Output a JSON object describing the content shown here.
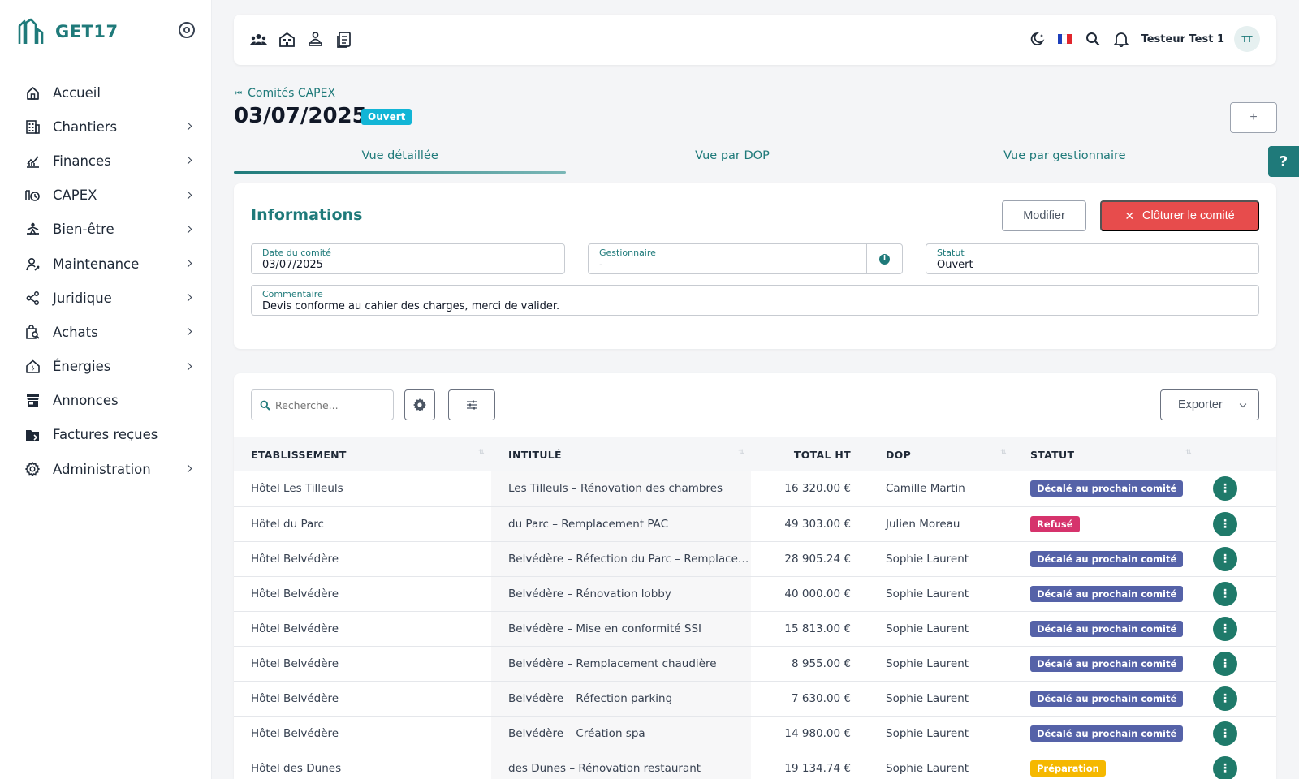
{
  "brand": {
    "name": "GET17",
    "color": "#1f7a7a"
  },
  "sidebar": {
    "items": [
      {
        "label": "Accueil",
        "icon": "home-icon",
        "chevron": false
      },
      {
        "label": "Chantiers",
        "icon": "building-icon",
        "chevron": true
      },
      {
        "label": "Finances",
        "icon": "chart-hand-icon",
        "chevron": true
      },
      {
        "label": "CAPEX",
        "icon": "capex-icon",
        "chevron": true
      },
      {
        "label": "Bien-être",
        "icon": "wellness-icon",
        "chevron": true
      },
      {
        "label": "Maintenance",
        "icon": "maintenance-icon",
        "chevron": true
      },
      {
        "label": "Juridique",
        "icon": "share-icon",
        "chevron": true
      },
      {
        "label": "Achats",
        "icon": "purchase-icon",
        "chevron": true
      },
      {
        "label": "Énergies",
        "icon": "energy-home-icon",
        "chevron": true
      },
      {
        "label": "Annonces",
        "icon": "store-icon",
        "chevron": false
      },
      {
        "label": "Factures reçues",
        "icon": "folder-invoice-icon",
        "chevron": false
      },
      {
        "label": "Administration",
        "icon": "gear-icon",
        "chevron": true
      }
    ]
  },
  "topbar": {
    "icons": [
      "users-icon",
      "hotel-icon",
      "person-desk-icon",
      "document-icon"
    ],
    "right_icons": [
      "dark-mode-icon",
      "french-flag-icon",
      "search-icon",
      "bell-icon"
    ],
    "user_name": "Testeur Test 1",
    "avatar_initials": "TT"
  },
  "header": {
    "breadcrumb": "Comités CAPEX",
    "title": "03/07/2025",
    "status_badge": "Ouvert",
    "add_label": "+"
  },
  "tabs": [
    {
      "label": "Vue détaillée",
      "active": true
    },
    {
      "label": "Vue par DOP",
      "active": false
    },
    {
      "label": "Vue par gestionnaire",
      "active": false
    }
  ],
  "help_label": "?",
  "info": {
    "title": "Informations",
    "modify_label": "Modifier",
    "close_label": "Clôturer le comité",
    "fields": {
      "date": {
        "label": "Date du comité",
        "value": "03/07/2025"
      },
      "manager": {
        "label": "Gestionnaire",
        "value": "-"
      },
      "status": {
        "label": "Statut",
        "value": "Ouvert"
      },
      "comment": {
        "label": "Commentaire",
        "value": "Devis conforme au cahier des charges, merci de valider."
      }
    }
  },
  "toolbar": {
    "search_placeholder": "Recherche...",
    "export_label": "Exporter"
  },
  "table": {
    "columns": [
      "ETABLISSEMENT",
      "INTITULÉ",
      "TOTAL HT",
      "DOP",
      "STATUT"
    ],
    "rows": [
      {
        "etab": "Hôtel Les Tilleuls",
        "intitule": "Les Tilleuls – Rénovation des chambres",
        "total": "16 320.00 €",
        "dop": "Camille Martin",
        "statut": "Décalé au prochain comité",
        "statut_color": "#5562a8"
      },
      {
        "etab": "Hôtel du Parc",
        "intitule": "du Parc – Remplacement PAC",
        "total": "49 303.00 €",
        "dop": "Julien Moreau",
        "statut": "Refusé",
        "statut_color": "#d6336c"
      },
      {
        "etab": "Hôtel Belvédère",
        "intitule": "Belvédère – Réfection du Parc – Remplace…",
        "total": "28 905.24 €",
        "dop": "Sophie Laurent",
        "statut": "Décalé au prochain comité",
        "statut_color": "#5562a8"
      },
      {
        "etab": "Hôtel Belvédère",
        "intitule": "Belvédère – Rénovation lobby",
        "total": "40 000.00 €",
        "dop": "Sophie Laurent",
        "statut": "Décalé au prochain comité",
        "statut_color": "#5562a8"
      },
      {
        "etab": "Hôtel Belvédère",
        "intitule": "Belvédère – Mise en conformité SSI",
        "total": "15 813.00 €",
        "dop": "Sophie Laurent",
        "statut": "Décalé au prochain comité",
        "statut_color": "#5562a8"
      },
      {
        "etab": "Hôtel Belvédère",
        "intitule": "Belvédère – Remplacement chaudière",
        "total": "8 955.00 €",
        "dop": "Sophie Laurent",
        "statut": "Décalé au prochain comité",
        "statut_color": "#5562a8"
      },
      {
        "etab": "Hôtel Belvédère",
        "intitule": "Belvédère – Réfection parking",
        "total": "7 630.00 €",
        "dop": "Sophie Laurent",
        "statut": "Décalé au prochain comité",
        "statut_color": "#5562a8"
      },
      {
        "etab": "Hôtel Belvédère",
        "intitule": "Belvédère – Création spa",
        "total": "14 980.00 €",
        "dop": "Sophie Laurent",
        "statut": "Décalé au prochain comité",
        "statut_color": "#5562a8"
      },
      {
        "etab": "Hôtel des Dunes",
        "intitule": "des Dunes – Rénovation restaurant",
        "total": "19 134.74 €",
        "dop": "Sophie Laurent",
        "statut": "Préparation",
        "statut_color": "#f5b800"
      }
    ]
  }
}
